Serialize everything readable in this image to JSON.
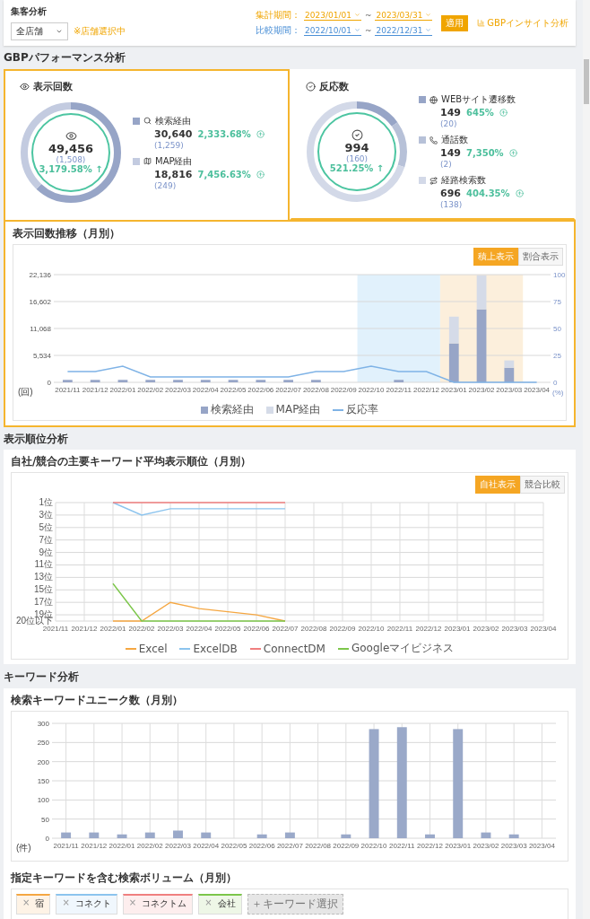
{
  "header": {
    "title": "集客分析",
    "store_select": {
      "value": "全店舗"
    },
    "store_note": "※店舗選択中",
    "periods": [
      {
        "label": "集計期間：",
        "kind": "current",
        "from": "2023/01/01",
        "sep": "~",
        "to": "2023/03/31"
      },
      {
        "label": "比較期間：",
        "kind": "compare",
        "from": "2022/10/01",
        "sep": "~",
        "to": "2022/12/31"
      }
    ],
    "apply_button": "適用",
    "insight_link": "GBPインサイト分析"
  },
  "performance": {
    "section_title": "GBPパフォーマンス分析",
    "cards": [
      {
        "title": "表示回数",
        "kind": "views",
        "selected": true,
        "total": "49,456",
        "previous": "(1,508)",
        "change": "3,179.58% ↑",
        "items": [
          {
            "label": "検索経由",
            "kind": "search",
            "color": "#97a5c7",
            "value": "30,640",
            "previous": "(1,259)",
            "change": "2,333.68%"
          },
          {
            "label": "MAP経由",
            "kind": "map",
            "color": "#c3cbe0",
            "value": "18,816",
            "previous": "(249)",
            "change": "7,456.63%"
          }
        ]
      },
      {
        "title": "反応数",
        "kind": "reactions",
        "selected": false,
        "total": "994",
        "previous": "(160)",
        "change": "521.25% ↑",
        "items": [
          {
            "label": "WEBサイト遷移数",
            "kind": "web",
            "color": "#97a5c7",
            "value": "149",
            "previous": "(20)",
            "change": "645%"
          },
          {
            "label": "通話数",
            "kind": "call",
            "color": "#b7c1d8",
            "value": "149",
            "previous": "(2)",
            "change": "7,350%"
          },
          {
            "label": "経路検索数",
            "kind": "route",
            "color": "#d3d9e8",
            "value": "696",
            "previous": "(138)",
            "change": "404.35%"
          }
        ]
      }
    ],
    "trend": {
      "title": "表示回数推移（月別）",
      "toggle": [
        {
          "label": "積上表示",
          "selected": true
        },
        {
          "label": "割合表示",
          "selected": false
        }
      ],
      "y_unit": "(回)",
      "y2_unit": "(%)",
      "chart_data": {
        "type": "bar",
        "stacked": true,
        "grid": true,
        "categories": [
          "2021/11",
          "2021/12",
          "2022/01",
          "2022/02",
          "2022/03",
          "2022/04",
          "2022/05",
          "2022/06",
          "2022/07",
          "2022/08",
          "2022/09",
          "2022/10",
          "2022/11",
          "2022/12",
          "2023/01",
          "2023/02",
          "2023/03",
          "2023/04"
        ],
        "ylim": [
          0,
          22136
        ],
        "yticks": [
          {
            "value": 0,
            "label": "0"
          },
          {
            "value": 5534,
            "label": "5,534"
          },
          {
            "value": 11068,
            "label": "11,068"
          },
          {
            "value": 16602,
            "label": "16,602"
          },
          {
            "value": 22136,
            "label": "22,136"
          }
        ],
        "y2lim": [
          0,
          100
        ],
        "y2ticks": [
          0,
          25,
          50,
          75,
          100
        ],
        "bands": [
          {
            "from": "2022/10",
            "to": "2022/12",
            "color": "#e1f1fc"
          },
          {
            "from": "2023/01",
            "to": "2023/03",
            "color": "#fcefdc"
          }
        ],
        "series": [
          {
            "name": "検索経由",
            "type": "bar",
            "color": "#97a5c7",
            "values": [
              500,
              500,
              500,
              500,
              500,
              500,
              500,
              500,
              500,
              500,
              0,
              0,
              500,
              0,
              8000,
              15000,
              3000,
              0
            ]
          },
          {
            "name": "MAP経由",
            "type": "bar",
            "color": "#d5dbe8",
            "values": [
              0,
              0,
              0,
              0,
              0,
              0,
              0,
              0,
              0,
              0,
              0,
              0,
              0,
              0,
              5500,
              7000,
              1500,
              0
            ]
          },
          {
            "name": "反応率",
            "type": "line",
            "axis": "y2",
            "color": "#7fb3e6",
            "values": [
              10,
              10,
              15,
              5,
              5,
              5,
              5,
              5,
              5,
              10,
              10,
              15,
              10,
              10,
              0,
              0,
              0,
              0
            ]
          }
        ]
      }
    }
  },
  "ranking": {
    "section_title": "表示順位分析",
    "title": "自社/競合の主要キーワード平均表示順位（月別）",
    "toggle": [
      {
        "label": "自社表示",
        "selected": true
      },
      {
        "label": "競合比較",
        "selected": false
      }
    ],
    "chart_data": {
      "type": "line",
      "grid": true,
      "categories": [
        "2021/11",
        "2021/12",
        "2022/01",
        "2022/02",
        "2022/03",
        "2022/04",
        "2022/05",
        "2022/06",
        "2022/07",
        "2022/08",
        "2022/09",
        "2022/10",
        "2022/11",
        "2022/12",
        "2023/01",
        "2023/02",
        "2023/03",
        "2023/04"
      ],
      "ylim": [
        20,
        1
      ],
      "yticks": [
        {
          "value": 1,
          "label": "1位"
        },
        {
          "value": 3,
          "label": "3位"
        },
        {
          "value": 5,
          "label": "5位"
        },
        {
          "value": 7,
          "label": "7位"
        },
        {
          "value": 9,
          "label": "9位"
        },
        {
          "value": 11,
          "label": "11位"
        },
        {
          "value": 13,
          "label": "13位"
        },
        {
          "value": 15,
          "label": "15位"
        },
        {
          "value": 17,
          "label": "17位"
        },
        {
          "value": 19,
          "label": "19位"
        },
        {
          "value": 20,
          "label": "20位以下"
        }
      ],
      "series": [
        {
          "name": "Excel",
          "color": "#f5a742",
          "values": [
            null,
            null,
            20,
            20,
            17,
            18,
            18.5,
            19,
            20,
            null,
            null,
            null,
            null,
            null,
            null,
            null,
            null,
            null
          ]
        },
        {
          "name": "ExcelDB",
          "color": "#8cc4ee",
          "values": [
            null,
            null,
            1,
            3,
            2,
            2,
            2,
            2,
            2,
            null,
            null,
            null,
            null,
            null,
            null,
            null,
            null,
            null
          ]
        },
        {
          "name": "ConnectDM",
          "color": "#f07f7f",
          "values": [
            null,
            null,
            1,
            1,
            1,
            1,
            1,
            1,
            1,
            null,
            null,
            null,
            null,
            null,
            null,
            null,
            null,
            null
          ]
        },
        {
          "name": "Googleマイビジネス",
          "color": "#7cc64a",
          "values": [
            null,
            null,
            14,
            20,
            20,
            20,
            20,
            20,
            20,
            null,
            null,
            null,
            null,
            null,
            null,
            null,
            null,
            null
          ]
        }
      ]
    }
  },
  "keywords": {
    "section_title": "キーワード分析",
    "title": "検索キーワードユニーク数（月別）",
    "y_unit": "(件)",
    "chart_data": {
      "type": "bar",
      "grid": true,
      "categories": [
        "2021/11",
        "2021/12",
        "2022/01",
        "2022/02",
        "2022/03",
        "2022/04",
        "2022/05",
        "2022/06",
        "2022/07",
        "2022/08",
        "2022/09",
        "2022/10",
        "2022/11",
        "2022/12",
        "2023/01",
        "2023/02",
        "2023/03",
        "2023/04"
      ],
      "ylim": [
        0,
        300
      ],
      "yticks": [
        0,
        50,
        100,
        150,
        200,
        250,
        300
      ],
      "series": [
        {
          "color": "#9aa9c9",
          "values": [
            15,
            15,
            10,
            15,
            20,
            15,
            0,
            10,
            15,
            0,
            10,
            285,
            290,
            10,
            285,
            15,
            10,
            0
          ]
        }
      ]
    }
  },
  "volume": {
    "title": "指定キーワードを含む検索ボリューム（月別）",
    "tags": [
      {
        "label": "宿",
        "color": "#f5a742"
      },
      {
        "label": "コネクト",
        "color": "#8cc4ee"
      },
      {
        "label": "コネクトム",
        "color": "#f07f7f"
      },
      {
        "label": "会社",
        "color": "#7cc64a"
      }
    ],
    "remove_mark": "×",
    "add_button": {
      "label": "キーワード選択",
      "disabled": true
    }
  }
}
